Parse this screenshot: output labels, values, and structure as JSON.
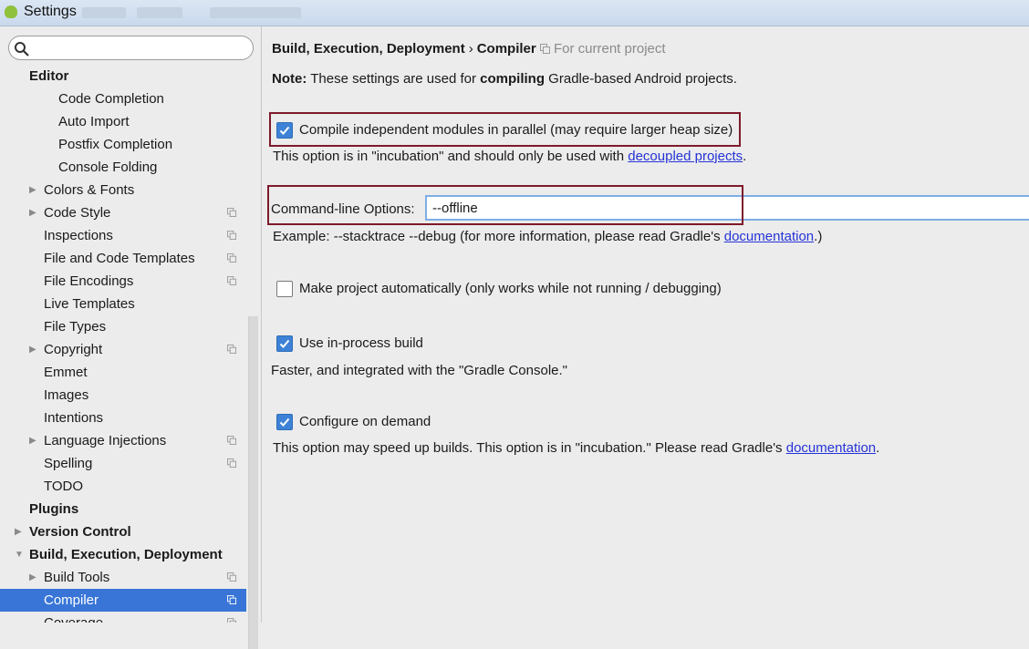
{
  "window": {
    "title": "Settings"
  },
  "search": {
    "value": "",
    "placeholder": ""
  },
  "sidebar": {
    "items": [
      {
        "label": "Editor",
        "indent": 0,
        "bold": true,
        "arrow": "",
        "project": false,
        "selected": false
      },
      {
        "label": "Code Completion",
        "indent": 2,
        "bold": false,
        "arrow": "",
        "project": false,
        "selected": false
      },
      {
        "label": "Auto Import",
        "indent": 2,
        "bold": false,
        "arrow": "",
        "project": false,
        "selected": false
      },
      {
        "label": "Postfix Completion",
        "indent": 2,
        "bold": false,
        "arrow": "",
        "project": false,
        "selected": false
      },
      {
        "label": "Console Folding",
        "indent": 2,
        "bold": false,
        "arrow": "",
        "project": false,
        "selected": false
      },
      {
        "label": "Colors & Fonts",
        "indent": 1,
        "bold": false,
        "arrow": "collapsed",
        "project": false,
        "selected": false
      },
      {
        "label": "Code Style",
        "indent": 1,
        "bold": false,
        "arrow": "collapsed",
        "project": true,
        "selected": false
      },
      {
        "label": "Inspections",
        "indent": 1,
        "bold": false,
        "arrow": "",
        "project": true,
        "selected": false
      },
      {
        "label": "File and Code Templates",
        "indent": 1,
        "bold": false,
        "arrow": "",
        "project": true,
        "selected": false
      },
      {
        "label": "File Encodings",
        "indent": 1,
        "bold": false,
        "arrow": "",
        "project": true,
        "selected": false
      },
      {
        "label": "Live Templates",
        "indent": 1,
        "bold": false,
        "arrow": "",
        "project": false,
        "selected": false
      },
      {
        "label": "File Types",
        "indent": 1,
        "bold": false,
        "arrow": "",
        "project": false,
        "selected": false
      },
      {
        "label": "Copyright",
        "indent": 1,
        "bold": false,
        "arrow": "collapsed",
        "project": true,
        "selected": false
      },
      {
        "label": "Emmet",
        "indent": 1,
        "bold": false,
        "arrow": "",
        "project": false,
        "selected": false
      },
      {
        "label": "Images",
        "indent": 1,
        "bold": false,
        "arrow": "",
        "project": false,
        "selected": false
      },
      {
        "label": "Intentions",
        "indent": 1,
        "bold": false,
        "arrow": "",
        "project": false,
        "selected": false
      },
      {
        "label": "Language Injections",
        "indent": 1,
        "bold": false,
        "arrow": "collapsed",
        "project": true,
        "selected": false
      },
      {
        "label": "Spelling",
        "indent": 1,
        "bold": false,
        "arrow": "",
        "project": true,
        "selected": false
      },
      {
        "label": "TODO",
        "indent": 1,
        "bold": false,
        "arrow": "",
        "project": false,
        "selected": false
      },
      {
        "label": "Plugins",
        "indent": 0,
        "bold": true,
        "arrow": "",
        "project": false,
        "selected": false
      },
      {
        "label": "Version Control",
        "indent": 0,
        "bold": true,
        "arrow": "collapsed",
        "project": false,
        "selected": false
      },
      {
        "label": "Build, Execution, Deployment",
        "indent": 0,
        "bold": true,
        "arrow": "expanded",
        "project": false,
        "selected": false
      },
      {
        "label": "Build Tools",
        "indent": 1,
        "bold": false,
        "arrow": "collapsed",
        "project": true,
        "selected": false
      },
      {
        "label": "Compiler",
        "indent": 1,
        "bold": false,
        "arrow": "",
        "project": true,
        "selected": true
      },
      {
        "label": "Coverage",
        "indent": 1,
        "bold": false,
        "arrow": "",
        "project": true,
        "selected": false
      }
    ]
  },
  "main": {
    "breadcrumb": {
      "parent": "Build, Execution, Deployment",
      "separator": "›",
      "current": "Compiler"
    },
    "scope": "For current project",
    "note": {
      "prefix": "Note:",
      "text1": " These settings are used for ",
      "bold": "compiling",
      "text2": " Gradle-based Android projects."
    },
    "parallel": {
      "label": "Compile independent modules in parallel (may require larger heap size)",
      "checked": true,
      "desc_prefix": "This option is in \"incubation\" and should only be used with ",
      "desc_link": "decoupled projects",
      "desc_suffix": "."
    },
    "cmdline": {
      "label": "Command-line Options:",
      "value": "--offline",
      "example_prefix": "Example: --stacktrace --debug (for more information, please read Gradle's ",
      "example_link": "documentation",
      "example_suffix": ".)"
    },
    "make_auto": {
      "label": "Make project automatically (only works while not running / debugging)",
      "checked": false
    },
    "in_process": {
      "label": "Use in-process build",
      "checked": true,
      "desc": "Faster, and integrated with the \"Gradle Console.\""
    },
    "configure_demand": {
      "label": "Configure on demand",
      "checked": true,
      "desc_prefix": "This option may speed up builds. This option is in \"incubation.\" Please read Gradle's ",
      "desc_link": "documentation",
      "desc_suffix": "."
    }
  },
  "colors": {
    "selection": "#3875d7",
    "checkbox": "#3d82d6",
    "highlight": "#7d1a2a",
    "link": "#2433d6"
  },
  "icons": {
    "search": "search-icon",
    "project_scope": "project-scope-icon",
    "tree_collapsed": "chevron-right-icon",
    "tree_expanded": "chevron-down-icon",
    "checkmark": "checkmark-icon"
  }
}
